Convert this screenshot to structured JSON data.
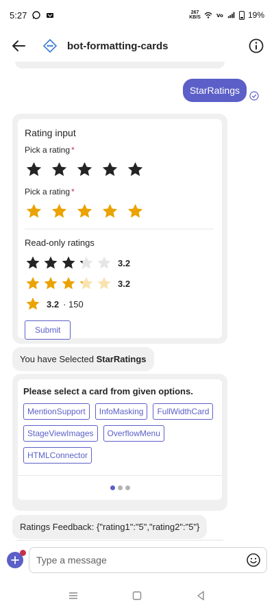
{
  "status": {
    "time": "5:27",
    "net_speed_value": "267",
    "net_speed_unit": "KB/S",
    "battery": "19%"
  },
  "header": {
    "title": "bot-formatting-cards"
  },
  "sent_message": {
    "text": "StarRatings"
  },
  "rating_card": {
    "title": "Rating input",
    "pick_label_1": "Pick a rating",
    "pick_label_2": "Pick a rating",
    "required_mark": "*",
    "readonly_title": "Read-only ratings",
    "readonly": [
      {
        "value": 3.2,
        "display": "3.2",
        "color": "dark"
      },
      {
        "value": 3.2,
        "display": "3.2",
        "color": "gold"
      },
      {
        "value": 3.2,
        "display": "3.2",
        "count": "· 150",
        "color": "gold"
      }
    ],
    "submit_label": "Submit"
  },
  "selected_message": {
    "prefix": "You have Selected ",
    "bold": "StarRatings"
  },
  "carousel_card": {
    "title": "Please select a card from given options.",
    "options": [
      "MentionSupport",
      "InfoMasking",
      "FullWidthCard",
      "StageViewImages",
      "OverflowMenu",
      "HTMLConnector"
    ],
    "dots": 3,
    "active_dot": 0
  },
  "feedback_message": {
    "text": "Ratings Feedback: {\"rating1\":\"5\",\"rating2\":\"5\"}"
  },
  "compose": {
    "placeholder": "Type a message"
  },
  "colors": {
    "brand": "#5b5fc7",
    "star_dark": "#242424",
    "star_gold": "#eaa300",
    "star_gold_empty": "#f8e3b0",
    "star_dark_empty": "#e6e6e6",
    "required": "#c4314b"
  },
  "icons": {
    "back": "arrow-left-icon",
    "bot": "bot-connector-icon",
    "info": "info-circle-icon",
    "read": "read-receipt-icon",
    "emoji": "emoji-icon",
    "plus": "plus-icon"
  }
}
